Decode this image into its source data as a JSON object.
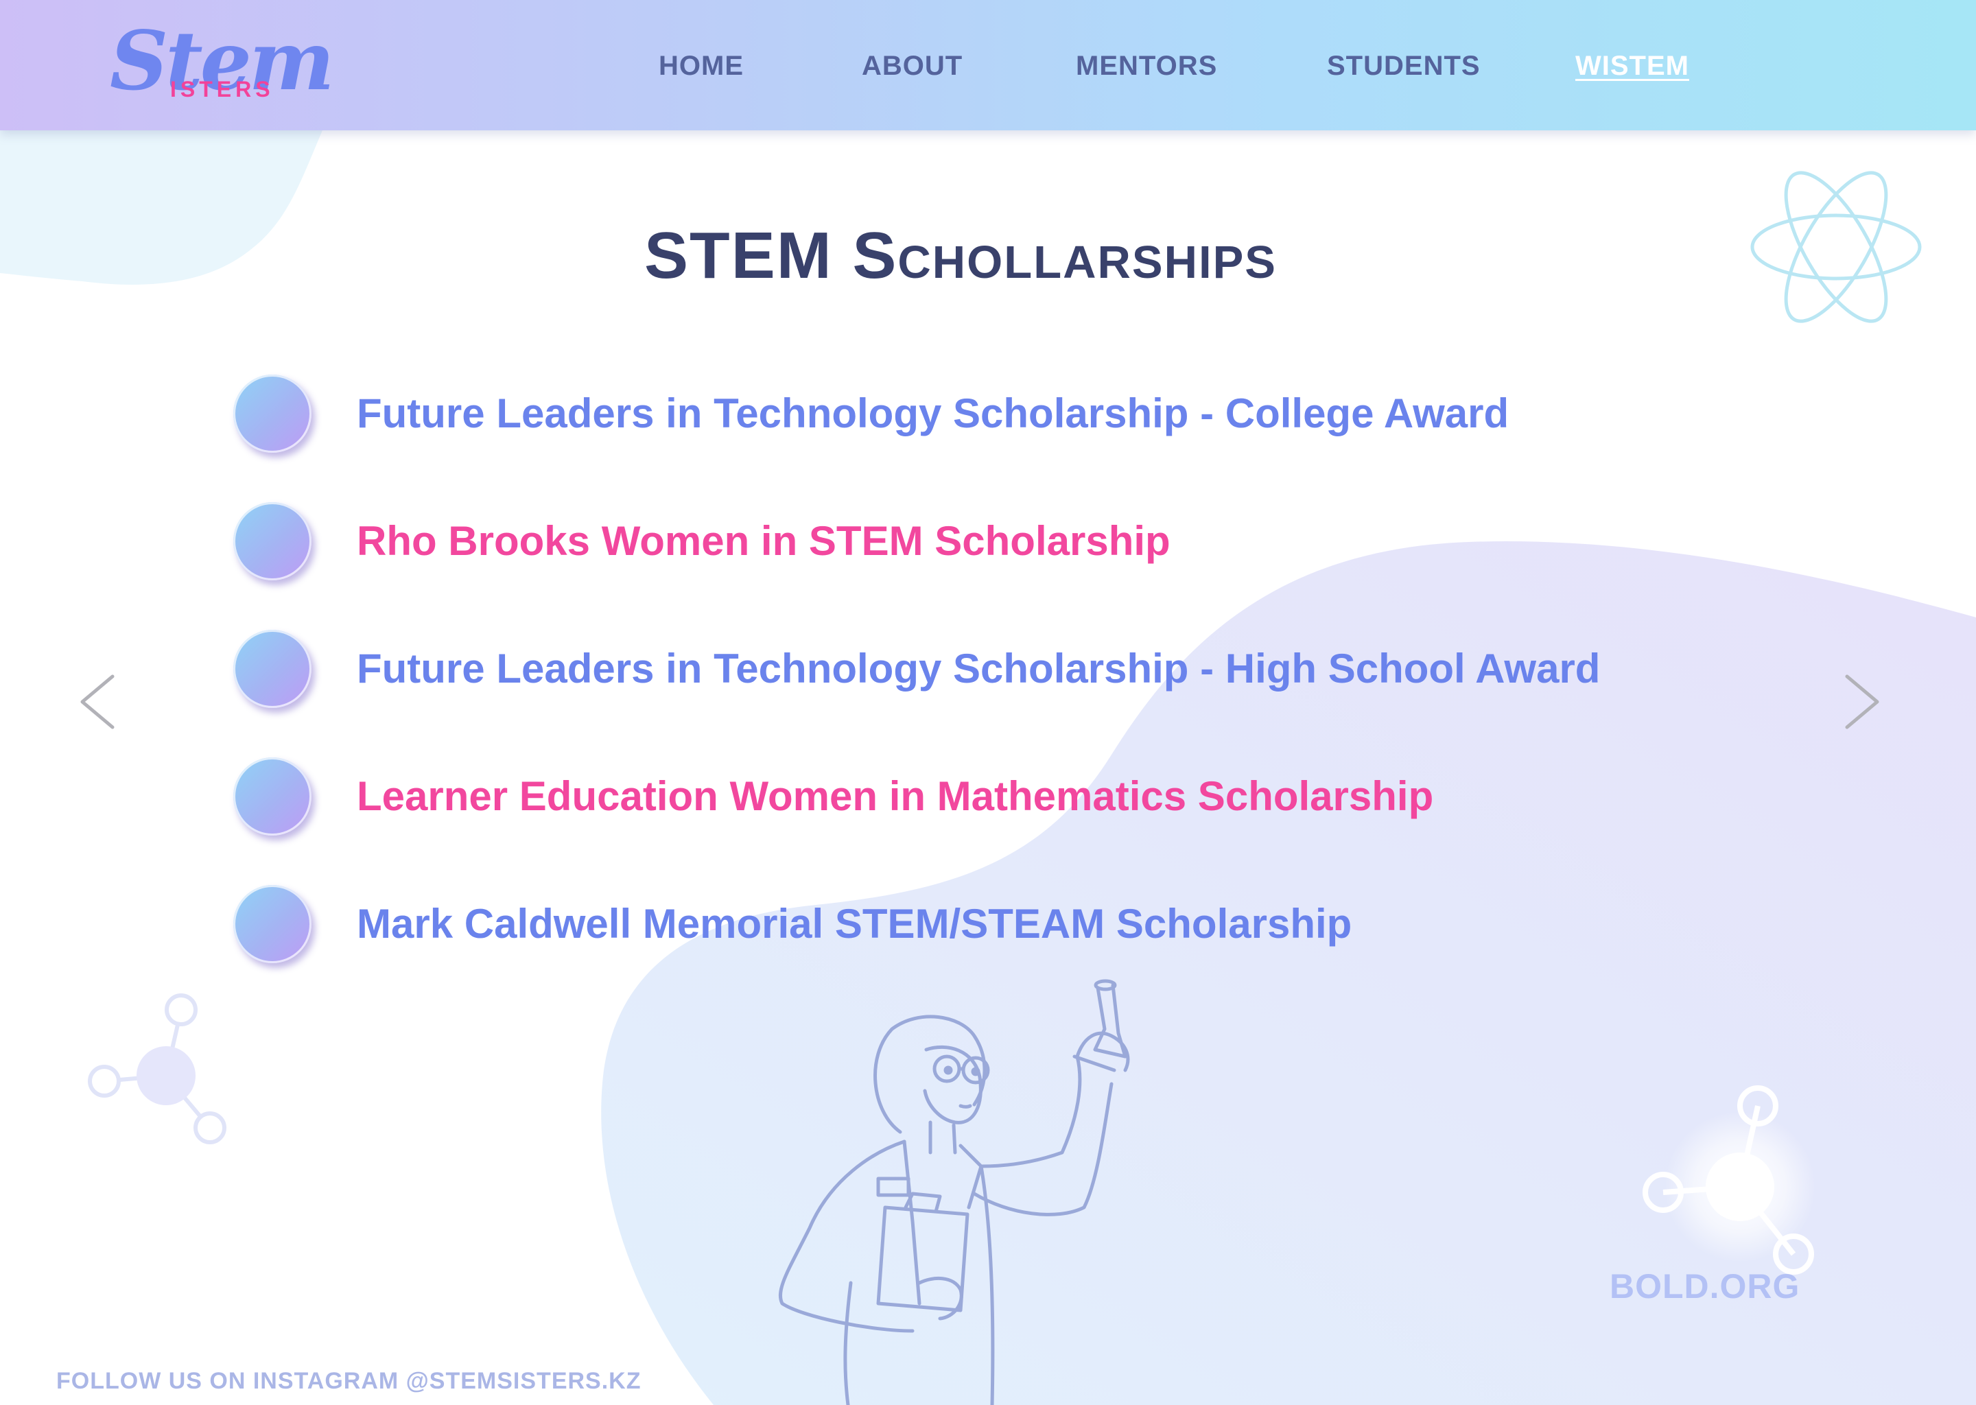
{
  "brand": {
    "logo_main": "Stem",
    "logo_sub": "ISTERS"
  },
  "nav": {
    "items": [
      {
        "label": "HOME"
      },
      {
        "label": "ABOUT"
      },
      {
        "label": "MENTORS"
      },
      {
        "label": "STUDENTS"
      },
      {
        "label": "WISTEM",
        "active": true
      }
    ]
  },
  "page": {
    "title_part1": "STEM ",
    "title_part2": "Schollarships"
  },
  "scholarships": [
    {
      "label": "Future Leaders in Technology Scholarship - College Award",
      "color": "#6a83ec"
    },
    {
      "label": "Rho Brooks Women in STEM Scholarship",
      "color": "#f2479e"
    },
    {
      "label": "Future Leaders in Technology Scholarship - High School Award",
      "color": "#6a83ec"
    },
    {
      "label": "Learner Education Women in Mathematics Scholarship",
      "color": "#f2479e"
    },
    {
      "label": "Mark Caldwell Memorial STEM/STEAM Scholarship",
      "color": "#6a83ec"
    }
  ],
  "carousel": {
    "prev_icon": "chevron-left-icon",
    "next_icon": "chevron-right-icon"
  },
  "footer": {
    "follow_text": "FOLLOW US ON INSTAGRAM @STEMSISTERS.KZ",
    "source_text": "BOLD.ORG"
  },
  "decor": {
    "icons": [
      "atom-icon",
      "molecule-icon",
      "scientist-illustration"
    ]
  }
}
